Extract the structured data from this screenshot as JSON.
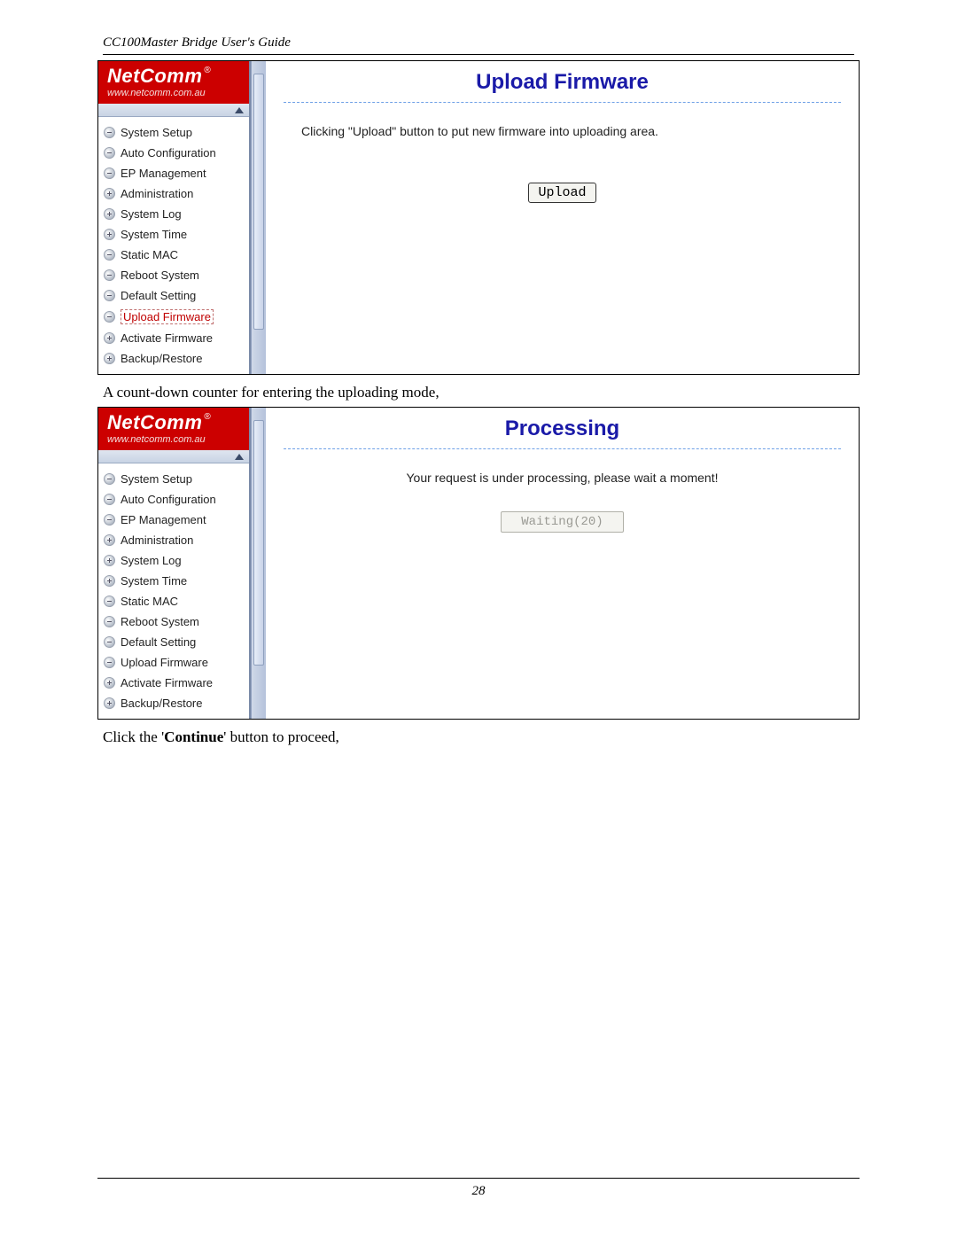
{
  "doc_header": "CC100Master Bridge User's Guide",
  "logo_text": "NetComm",
  "logo_reg": "®",
  "logo_url": "www.netcomm.com.au",
  "nav_items": [
    {
      "label": "System Setup",
      "icon": "minus"
    },
    {
      "label": "Auto Configuration",
      "icon": "minus"
    },
    {
      "label": "EP Management",
      "icon": "minus"
    },
    {
      "label": "Administration",
      "icon": "plus"
    },
    {
      "label": "System Log",
      "icon": "plus"
    },
    {
      "label": "System Time",
      "icon": "plus"
    },
    {
      "label": "Static MAC",
      "icon": "minus"
    },
    {
      "label": "Reboot System",
      "icon": "minus"
    },
    {
      "label": "Default Setting",
      "icon": "minus"
    },
    {
      "label": "Upload Firmware",
      "icon": "minus"
    },
    {
      "label": "Activate Firmware",
      "icon": "plus"
    },
    {
      "label": "Backup/Restore",
      "icon": "plus"
    }
  ],
  "screenshot1": {
    "title": "Upload Firmware",
    "instruction": "Clicking \"Upload\" button to put new firmware into uploading area.",
    "button": "Upload",
    "active_index": 9
  },
  "caption1": "A count-down counter for entering the uploading mode,",
  "screenshot2": {
    "title": "Processing",
    "instruction": "Your request is under processing, please wait a moment!",
    "button": "Waiting(20)",
    "active_index": -1
  },
  "caption2_pre": "Click the '",
  "caption2_bold": "Continue",
  "caption2_post": "' button to proceed,",
  "page_number": "28"
}
